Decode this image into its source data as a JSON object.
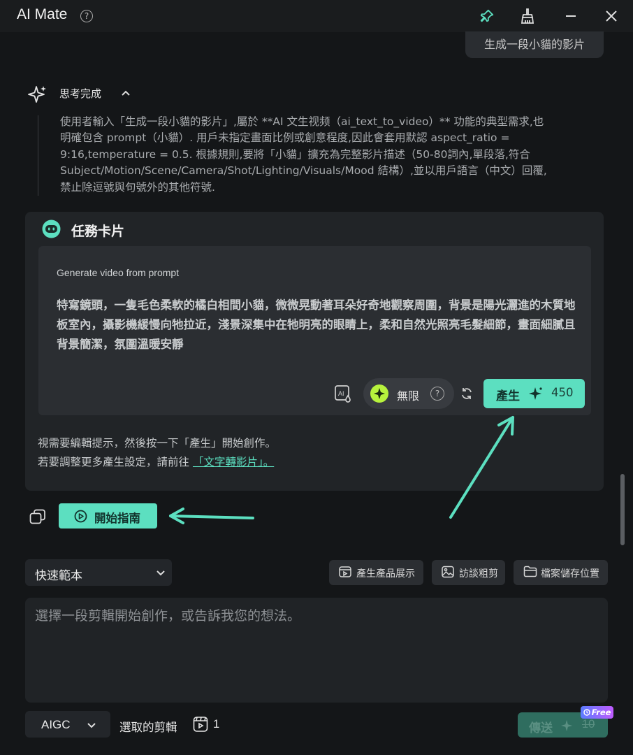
{
  "app": {
    "title": "AI Mate"
  },
  "chat": {
    "user_message": "生成一段小貓的影片",
    "thinking": {
      "title": "思考完成",
      "text": "使用者輸入「生成一段小貓的影片」,屬於 **AI 文生视频（ai_text_to_video）** 功能的典型需求,也\n明確包含 prompt（小貓）. 用戶未指定畫面比例或創意程度,因此會套用默認 aspect_ratio =\n9:16,temperature = 0.5. 根據規則,要將「小貓」擴充為完整影片描述（50-80詞內,單段落,符合\nSubject/Motion/Scene/Camera/Shot/Lighting/Visuals/Mood 結構）,並以用戶語言（中文）回覆,\n禁止除逗號與句號外的其他符號."
    },
    "task_card": {
      "title": "任務卡片",
      "label": "Generate video from prompt",
      "prompt": "特寫鏡頭，一隻毛色柔軟的橘白相間小貓，微微晃動著耳朵好奇地觀察周圍，背景是陽光灑進的木質地板室內，攝影機緩慢向牠拉近，淺景深集中在牠明亮的眼睛上，柔和自然光照亮毛髮細節，畫面細膩且背景簡潔，氛圍溫暖安靜",
      "unlimited_label": "無限",
      "generate_label": "產生",
      "generate_cost": "450",
      "hint_line1": "視需要編輯提示，然後按一下「產生」開始創作。",
      "hint_line2_prefix": "若要調整更多產生設定，請前往",
      "hint_link": "「文字轉影片」。"
    },
    "guide_label": "開始指南"
  },
  "composer": {
    "quick_template": "快速範本",
    "chips": [
      "產生產品展示",
      "訪談粗剪",
      "檔案儲存位置"
    ],
    "placeholder": "選擇一段剪輯開始創作，或告訴我您的想法。",
    "mode": "AIGC",
    "selected_label": "選取的剪輯",
    "selected_count": "1",
    "send_label": "傳送",
    "send_cost": "10",
    "free_badge": "Free"
  },
  "colors": {
    "accent": "#5cdfc0",
    "background": "#141618",
    "card": "#212427"
  }
}
